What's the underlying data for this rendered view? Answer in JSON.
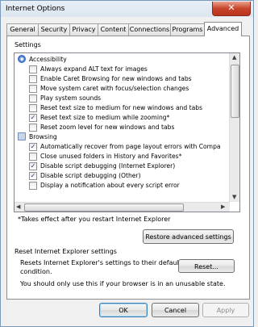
{
  "window": {
    "title": "Internet Options",
    "close_label": "✕"
  },
  "tabs": [
    {
      "label": "General"
    },
    {
      "label": "Security"
    },
    {
      "label": "Privacy"
    },
    {
      "label": "Content"
    },
    {
      "label": "Connections"
    },
    {
      "label": "Programs"
    },
    {
      "label": "Advanced"
    }
  ],
  "active_tab": "Advanced",
  "settings": {
    "heading": "Settings",
    "groups": [
      {
        "name": "Accessibility",
        "icon": "accessibility-icon"
      },
      {
        "name": "Browsing",
        "icon": "browsing-icon"
      }
    ],
    "items": [
      {
        "label": "Always expand ALT text for images",
        "checked": false
      },
      {
        "label": "Enable Caret Browsing for new windows and tabs",
        "checked": false
      },
      {
        "label": "Move system caret with focus/selection changes",
        "checked": false
      },
      {
        "label": "Play system sounds",
        "checked": false
      },
      {
        "label": "Reset text size to medium for new windows and tabs",
        "checked": false
      },
      {
        "label": "Reset text size to medium while zooming*",
        "checked": true
      },
      {
        "label": "Reset zoom level for new windows and tabs",
        "checked": false
      },
      {
        "label": "Automatically recover from page layout errors with Compa",
        "checked": true
      },
      {
        "label": "Close unused folders in History and Favorites*",
        "checked": false
      },
      {
        "label": "Disable script debugging (Internet Explorer)",
        "checked": true
      },
      {
        "label": "Disable script debugging (Other)",
        "checked": true
      },
      {
        "label": "Display a notification about every script error",
        "checked": false
      }
    ],
    "footnote": "*Takes effect after you restart Internet Explorer",
    "restore_label": "Restore advanced settings"
  },
  "reset": {
    "heading": "Reset Internet Explorer settings",
    "description_line1": "Resets Internet Explorer's settings to their default",
    "description_line2": "condition.",
    "warning": "You should only use this if your browser is in an unusable state.",
    "button_label": "Reset..."
  },
  "footer": {
    "ok_label": "OK",
    "cancel_label": "Cancel",
    "apply_label": "Apply"
  }
}
